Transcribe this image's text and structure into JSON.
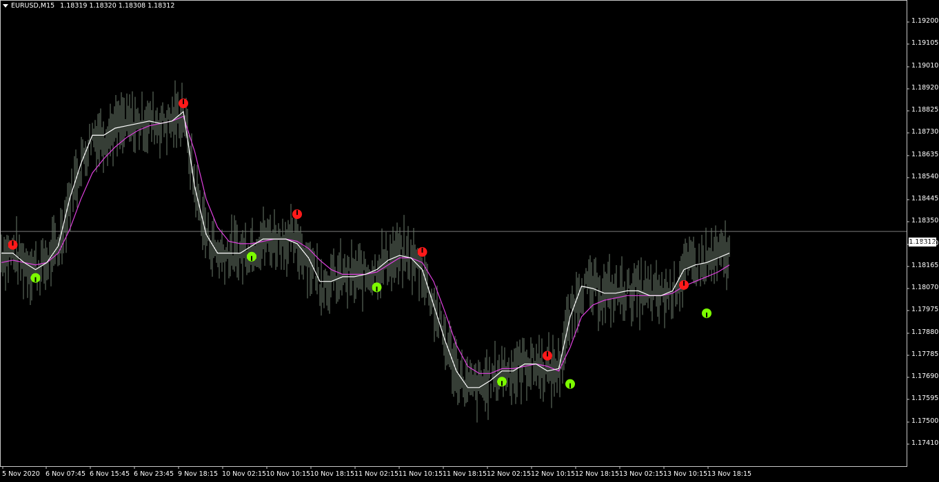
{
  "header": {
    "symbol": "EURUSD,M15",
    "quote": "1.18319 1.18320 1.18308 1.18312"
  },
  "price_axis": {
    "ticks": [
      "1.19200",
      "1.19105",
      "1.19010",
      "1.18920",
      "1.18825",
      "1.18730",
      "1.18635",
      "1.18540",
      "1.18445",
      "1.18350",
      "1.18260",
      "1.18165",
      "1.18070",
      "1.17975",
      "1.17880",
      "1.17785",
      "1.17690",
      "1.17595",
      "1.17500",
      "1.17410"
    ],
    "current_price": "1.18312"
  },
  "time_axis": {
    "ticks": [
      "5 Nov 2020",
      "6 Nov 07:45",
      "6 Nov 15:45",
      "6 Nov 23:45",
      "9 Nov 18:15",
      "10 Nov 02:15",
      "10 Nov 10:15",
      "10 Nov 18:15",
      "11 Nov 02:15",
      "11 Nov 10:15",
      "11 Nov 18:15",
      "12 Nov 02:15",
      "12 Nov 10:15",
      "12 Nov 18:15",
      "13 Nov 02:15",
      "13 Nov 10:15",
      "13 Nov 18:15"
    ]
  },
  "colors": {
    "background": "#000000",
    "bars": "#6b7b6b",
    "fast_ma": "#ffffff",
    "slow_ma": "#e040e0",
    "up_arrow": "#7cfc00",
    "down_arrow": "#ff1a1a",
    "price_line": "#c8c8c8"
  },
  "chart_data": {
    "type": "line",
    "price_range": [
      1.1741,
      1.1925
    ],
    "series": [
      {
        "values": [
          1.1822,
          1.1822,
          1.1818,
          1.1815,
          1.1818,
          1.1825,
          1.1845,
          1.186,
          1.1872,
          1.1872,
          1.1875,
          1.1876,
          1.1877,
          1.1878,
          1.1877,
          1.1878,
          1.1882,
          1.185,
          1.183,
          1.1822,
          1.1822,
          1.1822,
          1.1825,
          1.1828,
          1.1828,
          1.1828,
          1.1826,
          1.182,
          1.181,
          1.181,
          1.1812,
          1.1812,
          1.1813,
          1.1815,
          1.1819,
          1.1821,
          1.182,
          1.1815,
          1.18,
          1.1785,
          1.1772,
          1.1765,
          1.1765,
          1.1768,
          1.1772,
          1.1772,
          1.1775,
          1.1775,
          1.1772,
          1.1773,
          1.1795,
          1.1808,
          1.1807,
          1.1805,
          1.1805,
          1.1806,
          1.1806,
          1.1804,
          1.1804,
          1.1806,
          1.1815,
          1.1817,
          1.1818,
          1.182,
          1.1822
        ]
      },
      {
        "values": [
          1.1818,
          1.1819,
          1.1818,
          1.1817,
          1.1818,
          1.1822,
          1.1832,
          1.1845,
          1.1856,
          1.1862,
          1.1867,
          1.1871,
          1.1874,
          1.1876,
          1.1877,
          1.1878,
          1.188,
          1.1865,
          1.1845,
          1.1833,
          1.1827,
          1.1826,
          1.1826,
          1.1827,
          1.1828,
          1.1828,
          1.1827,
          1.1824,
          1.1819,
          1.1815,
          1.1813,
          1.1813,
          1.1813,
          1.1814,
          1.1817,
          1.182,
          1.182,
          1.1818,
          1.181,
          1.1797,
          1.1783,
          1.1774,
          1.1771,
          1.1771,
          1.1773,
          1.1773,
          1.1774,
          1.1775,
          1.1774,
          1.1772,
          1.1782,
          1.1795,
          1.18,
          1.1802,
          1.1803,
          1.1804,
          1.1804,
          1.1804,
          1.1804,
          1.1805,
          1.1808,
          1.181,
          1.1812,
          1.1814,
          1.1817
        ]
      }
    ],
    "signals": [
      {
        "type": "sell",
        "index": 1,
        "price": 1.1822
      },
      {
        "type": "buy",
        "index": 3,
        "price": 1.1815
      },
      {
        "type": "sell",
        "index": 16,
        "price": 1.1882
      },
      {
        "type": "buy",
        "index": 22,
        "price": 1.1824
      },
      {
        "type": "sell",
        "index": 26,
        "price": 1.1835
      },
      {
        "type": "buy",
        "index": 33,
        "price": 1.1811
      },
      {
        "type": "sell",
        "index": 37,
        "price": 1.1819
      },
      {
        "type": "buy",
        "index": 44,
        "price": 1.1771
      },
      {
        "type": "sell",
        "index": 48,
        "price": 1.1775
      },
      {
        "type": "buy",
        "index": 50,
        "price": 1.177
      },
      {
        "type": "sell",
        "index": 60,
        "price": 1.1805
      },
      {
        "type": "buy",
        "index": 62,
        "price": 1.18
      }
    ]
  }
}
